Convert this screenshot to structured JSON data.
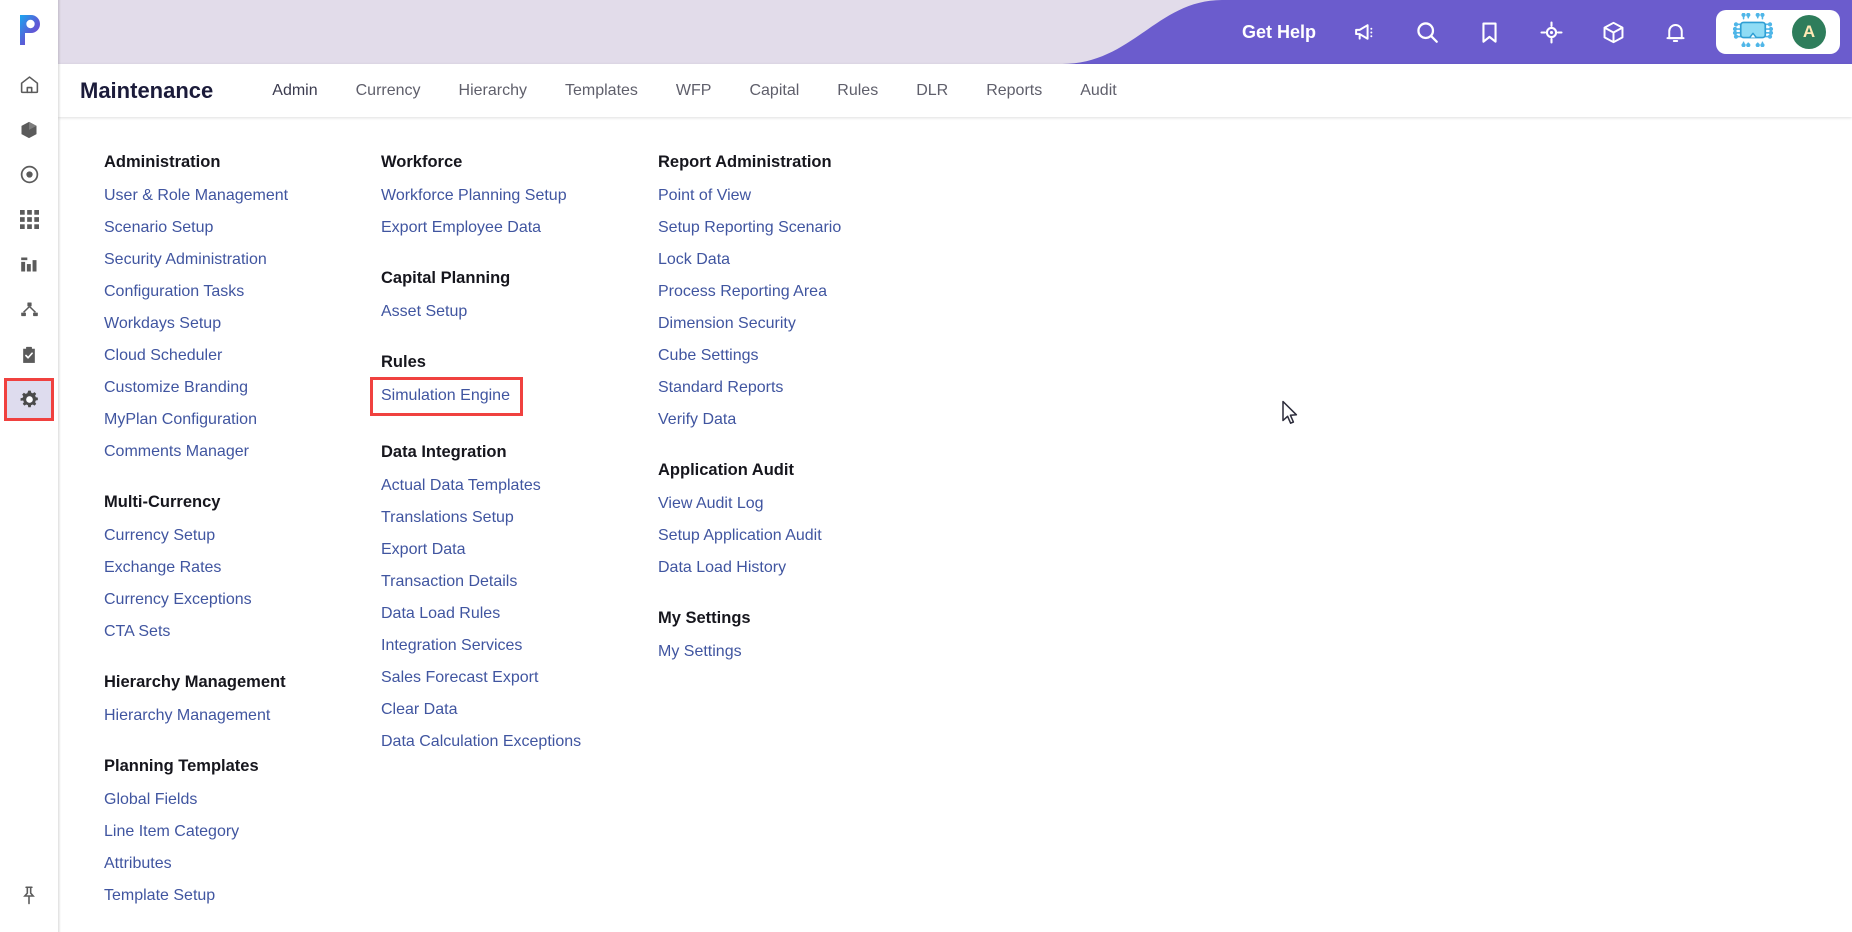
{
  "header": {
    "get_help_label": "Get Help",
    "icons": [
      {
        "name": "announcement-icon",
        "glyph": "megaphone"
      },
      {
        "name": "search-icon",
        "glyph": "search"
      },
      {
        "name": "bookmark-icon",
        "glyph": "bookmark"
      },
      {
        "name": "target-icon",
        "glyph": "target"
      },
      {
        "name": "package-icon",
        "glyph": "cube"
      },
      {
        "name": "notifications-icon",
        "glyph": "bell"
      }
    ],
    "ai-assistant_icon": "chip-icon",
    "avatar_initial": "A",
    "accent_purple": "#6b5ccd",
    "header_band": "#e2dcea"
  },
  "navbar": {
    "title": "Maintenance",
    "tabs": [
      {
        "label": "Admin",
        "active": true
      },
      {
        "label": "Currency",
        "active": false
      },
      {
        "label": "Hierarchy",
        "active": false
      },
      {
        "label": "Templates",
        "active": false
      },
      {
        "label": "WFP",
        "active": false
      },
      {
        "label": "Capital",
        "active": false
      },
      {
        "label": "Rules",
        "active": false
      },
      {
        "label": "DLR",
        "active": false
      },
      {
        "label": "Reports",
        "active": false
      },
      {
        "label": "Audit",
        "active": false
      }
    ]
  },
  "sidebar": {
    "logo": "planful-logo",
    "items": [
      {
        "name": "home-icon",
        "label": "Home",
        "active": false
      },
      {
        "name": "box-icon",
        "label": "Modeling",
        "active": false
      },
      {
        "name": "target-circle-icon",
        "label": "Target",
        "active": false
      },
      {
        "name": "grid-icon",
        "label": "Grid",
        "active": false
      },
      {
        "name": "bar-chart-icon",
        "label": "Reports",
        "active": false
      },
      {
        "name": "hierarchy-icon",
        "label": "Consolidation",
        "active": false
      },
      {
        "name": "clipboard-check-icon",
        "label": "Tasks",
        "active": false
      },
      {
        "name": "gear-icon",
        "label": "Maintenance",
        "active": true
      }
    ],
    "pin": {
      "name": "pin-icon",
      "label": "Pin menu"
    }
  },
  "menu": {
    "columns": [
      {
        "groups": [
          {
            "title": "Administration",
            "links": [
              "User & Role Management",
              "Scenario Setup",
              "Security Administration",
              "Configuration Tasks",
              "Workdays Setup",
              "Cloud Scheduler",
              "Customize Branding",
              "MyPlan Configuration",
              "Comments Manager"
            ]
          },
          {
            "title": "Multi-Currency",
            "links": [
              "Currency Setup",
              "Exchange Rates",
              "Currency Exceptions",
              "CTA Sets"
            ]
          },
          {
            "title": "Hierarchy Management",
            "links": [
              "Hierarchy Management"
            ]
          },
          {
            "title": "Planning Templates",
            "links": [
              "Global Fields",
              "Line Item Category",
              "Attributes",
              "Template Setup"
            ]
          }
        ]
      },
      {
        "groups": [
          {
            "title": "Workforce",
            "links": [
              "Workforce Planning Setup",
              "Export Employee Data"
            ]
          },
          {
            "title": "Capital Planning",
            "links": [
              "Asset Setup"
            ]
          },
          {
            "title": "Rules",
            "links": [
              "Simulation Engine"
            ],
            "highlighted": "Simulation Engine"
          },
          {
            "title": "Data Integration",
            "links": [
              "Actual Data Templates",
              "Translations Setup",
              "Export Data",
              "Transaction Details",
              "Data Load Rules",
              "Integration Services",
              "Sales Forecast Export",
              "Clear Data",
              "Data Calculation Exceptions"
            ]
          }
        ]
      },
      {
        "groups": [
          {
            "title": "Report Administration",
            "links": [
              "Point of View",
              "Setup Reporting Scenario",
              "Lock Data",
              "Process Reporting Area",
              "Dimension Security",
              "Cube Settings",
              "Standard Reports",
              "Verify Data"
            ]
          },
          {
            "title": "Application Audit",
            "links": [
              "View Audit Log",
              "Setup Application Audit",
              "Data Load History"
            ]
          },
          {
            "title": "My Settings",
            "links": [
              "My Settings"
            ]
          }
        ]
      }
    ]
  },
  "annotations": {
    "highlight_color": "#f0413f",
    "link_color": "#4055a0"
  }
}
